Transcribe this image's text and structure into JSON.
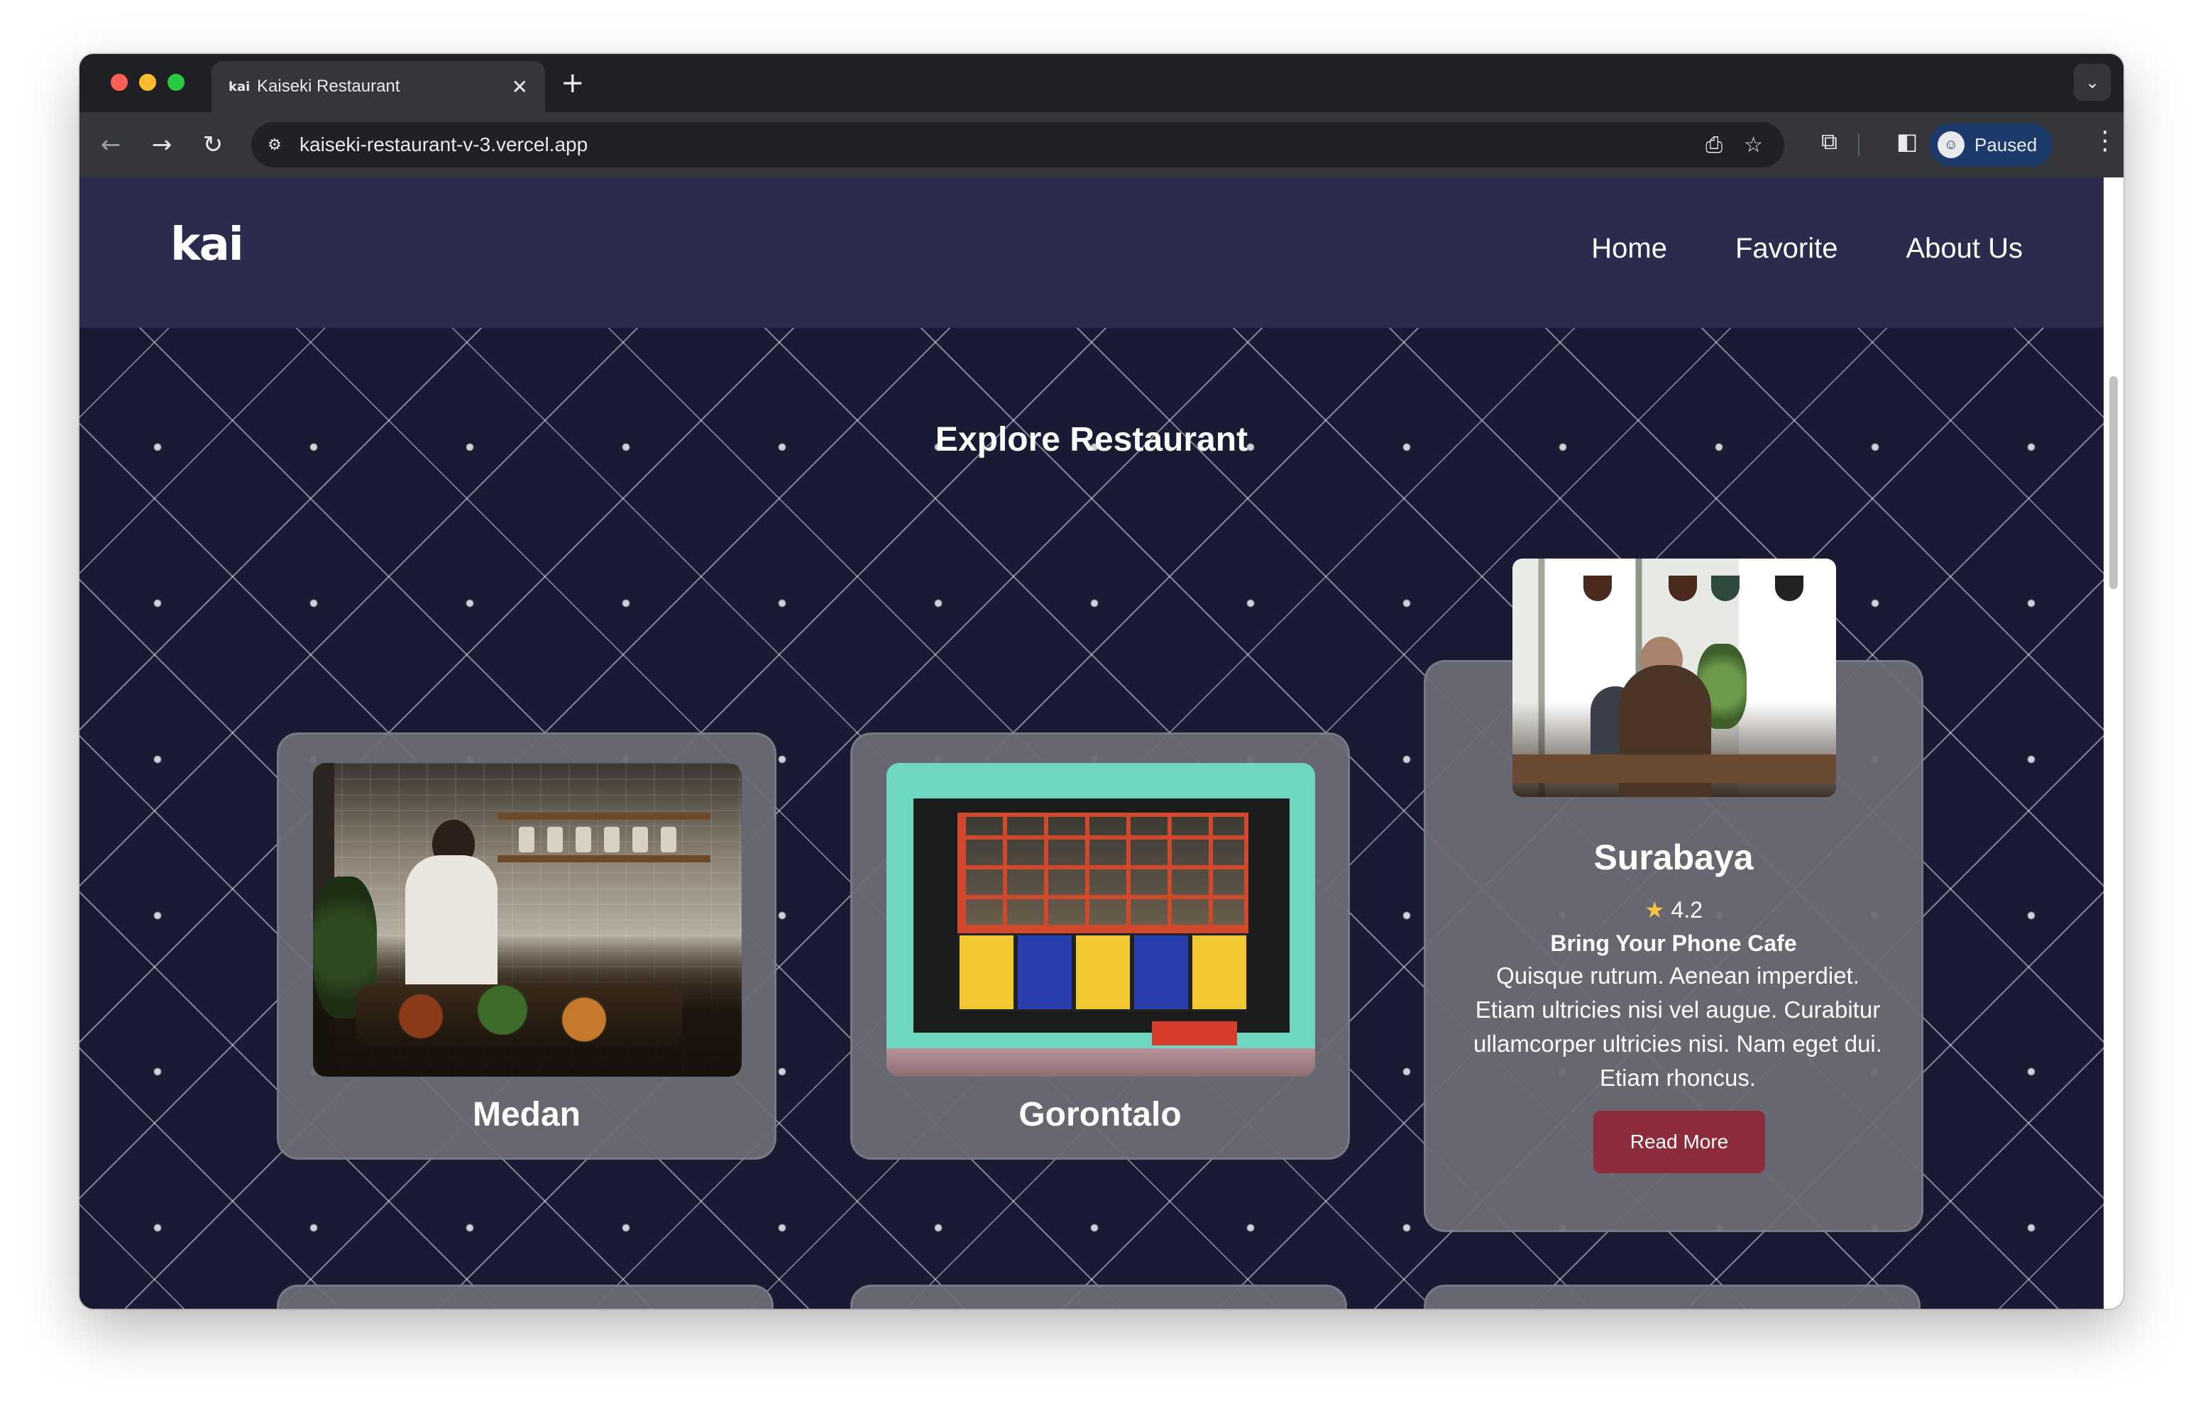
{
  "browser": {
    "tab_favicon": "kai",
    "tab_title": "Kaiseki Restaurant",
    "tab_close": "✕",
    "new_tab": "+",
    "url": "kaiseki-restaurant-v-3.vercel.app",
    "profile_label": "Paused"
  },
  "header": {
    "logo": "kai",
    "nav": [
      "Home",
      "Favorite",
      "About Us"
    ]
  },
  "main": {
    "title": "Explore Restaurant",
    "cards": [
      {
        "name": "Medan"
      },
      {
        "name": "Gorontalo"
      },
      {
        "name": "Surabaya",
        "rating": "4.2",
        "subtitle": "Bring Your Phone Cafe",
        "description": "Quisque rutrum. Aenean imperdiet. Etiam ultricies nisi vel augue. Curabitur ullamcorper ultricies nisi. Nam eget dui. Etiam rhoncus.",
        "button_label": "Read More"
      }
    ]
  },
  "colors": {
    "header_bg": "#2a2b4d",
    "page_bg": "#191a33",
    "card_bg": "#6c6b76",
    "button_bg": "#8c2b3c",
    "star": "#f4c542"
  },
  "icons": [
    "back-arrow-icon",
    "forward-arrow-icon",
    "reload-icon",
    "site-info-icon",
    "install-app-icon",
    "bookmark-star-icon",
    "extensions-icon",
    "side-panel-icon",
    "profile-avatar-icon",
    "more-menu-icon",
    "star-icon"
  ]
}
